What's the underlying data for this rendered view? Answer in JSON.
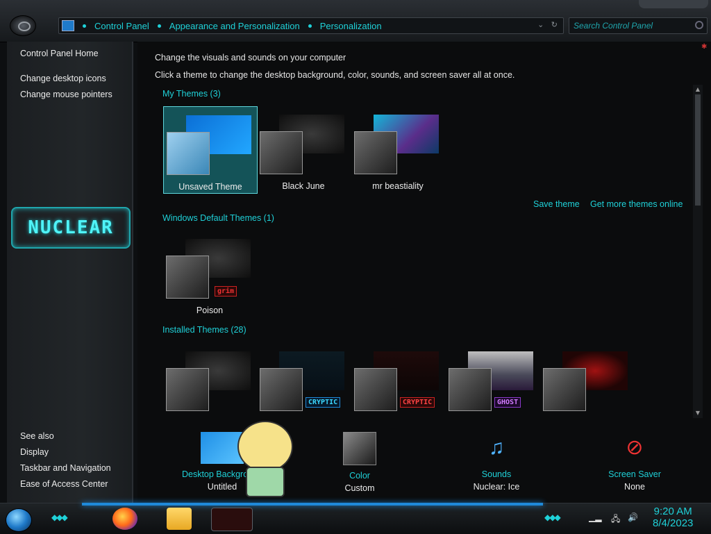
{
  "address_bar": {
    "breadcrumbs": [
      "Control Panel",
      "Appearance and Personalization",
      "Personalization"
    ],
    "dropdown_icon": "chevron-down-icon",
    "refresh_icon": "refresh-icon"
  },
  "search": {
    "placeholder": "Search Control Panel"
  },
  "sidebar": {
    "top_links": [
      "Control Panel Home",
      "Change desktop icons",
      "Change mouse pointers"
    ],
    "logo_text": "NUCLEAR",
    "see_also_label": "See also",
    "see_also_links": [
      "Display",
      "Taskbar and Navigation",
      "Ease of Access Center"
    ]
  },
  "main": {
    "heading": "Change the visuals and sounds on your computer",
    "subheading": "Click a theme to change the desktop background, color, sounds, and screen saver all at once.",
    "my_themes": {
      "label": "My Themes (3)",
      "themes": [
        {
          "name": "Unsaved Theme",
          "selected": true
        },
        {
          "name": "Black June",
          "selected": false
        },
        {
          "name": "mr beastiality",
          "selected": false
        }
      ]
    },
    "save_theme": "Save theme",
    "get_more": "Get more themes online",
    "default_themes": {
      "label": "Windows Default Themes (1)",
      "themes": [
        {
          "name": "Poison",
          "badge": "grim"
        }
      ]
    },
    "installed_themes": {
      "label": "Installed Themes (28)",
      "badges": [
        "",
        "CRYPTIC",
        "CRYPTIC",
        "GHOST",
        ""
      ]
    }
  },
  "bottom": {
    "items": [
      {
        "title": "Desktop Background",
        "value": "Untitled"
      },
      {
        "title": "Color",
        "value": "Custom"
      },
      {
        "title": "Sounds",
        "value": "Nuclear: Ice"
      },
      {
        "title": "Screen Saver",
        "value": "None"
      }
    ]
  },
  "taskbar": {
    "apps": [
      "firefox-icon",
      "file-explorer-icon",
      "personalization-window-icon"
    ],
    "clock_time": "9:20 AM",
    "clock_date": "8/4/2023"
  },
  "colors": {
    "accent": "#1fd1d8",
    "selection": "#1faab4",
    "taskbar_glow": "#1f89d9"
  }
}
